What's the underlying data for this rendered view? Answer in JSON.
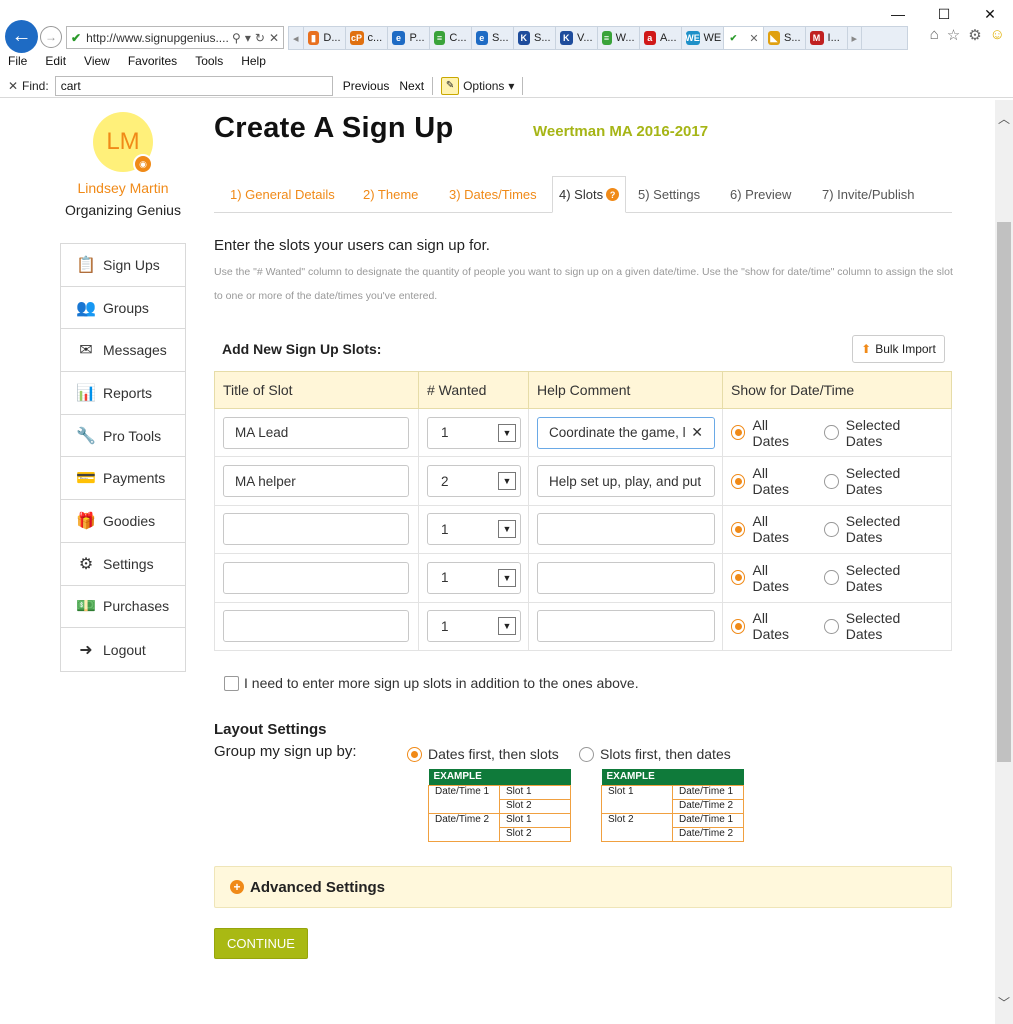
{
  "browser": {
    "address": "http://www.signupgenius....",
    "tabs": [
      {
        "label": "D...",
        "color": "#e8701f",
        "glyph": "▮"
      },
      {
        "label": "c...",
        "color": "#e07010",
        "glyph": "cP"
      },
      {
        "label": "P...",
        "color": "#1e6bc4",
        "glyph": "e"
      },
      {
        "label": "C...",
        "color": "#3aa33a",
        "glyph": "≡"
      },
      {
        "label": "S...",
        "color": "#1e6bc4",
        "glyph": "e"
      },
      {
        "label": "S...",
        "color": "#1e4c9c",
        "glyph": "K"
      },
      {
        "label": "V...",
        "color": "#1e4c9c",
        "glyph": "K"
      },
      {
        "label": "W...",
        "color": "#3aa33a",
        "glyph": "≡"
      },
      {
        "label": "A...",
        "color": "#d01818",
        "glyph": "a"
      },
      {
        "label": "WE",
        "color": "#1e90c8",
        "glyph": "WE"
      },
      {
        "label": "",
        "color": "#ffffff",
        "glyph": "✔"
      },
      {
        "label": "S...",
        "color": "#e0a010",
        "glyph": "◣"
      },
      {
        "label": "I...",
        "color": "#c02020",
        "glyph": "M"
      }
    ],
    "menu": [
      "File",
      "Edit",
      "View",
      "Favorites",
      "Tools",
      "Help"
    ],
    "find_label": "Find:",
    "find_value": "cart",
    "previous": "Previous",
    "next": "Next",
    "options": "Options"
  },
  "user": {
    "initials": "LM",
    "name": "Lindsey Martin",
    "role": "Organizing Genius"
  },
  "nav": [
    {
      "label": "Sign Ups",
      "icon": "clipboard-icon",
      "glyph": "📋"
    },
    {
      "label": "Groups",
      "icon": "people-icon",
      "glyph": "👥"
    },
    {
      "label": "Messages",
      "icon": "envelope-icon",
      "glyph": "✉"
    },
    {
      "label": "Reports",
      "icon": "bar-chart-icon",
      "glyph": "📊"
    },
    {
      "label": "Pro Tools",
      "icon": "wrench-icon",
      "glyph": "🔧"
    },
    {
      "label": "Payments",
      "icon": "credit-card-icon",
      "glyph": "💳"
    },
    {
      "label": "Goodies",
      "icon": "gift-icon",
      "glyph": "🎁"
    },
    {
      "label": "Settings",
      "icon": "gear-icon",
      "glyph": "⚙"
    },
    {
      "label": "Purchases",
      "icon": "money-icon",
      "glyph": "💵"
    },
    {
      "label": "Logout",
      "icon": "logout-icon",
      "glyph": "➜"
    }
  ],
  "page": {
    "title": "Create A Sign Up",
    "subtitle": "Weertman MA 2016-2017",
    "tabs": [
      "1) General Details",
      "2) Theme",
      "3) Dates/Times",
      "4) Slots",
      "5) Settings",
      "6) Preview",
      "7) Invite/Publish"
    ],
    "intro": "Enter the slots your users can sign up for.",
    "intro_help": "Use the \"# Wanted\" column to designate the quantity of people you want to sign up on a given date/time. Use the \"show for date/time\" column to assign the slot to one or more of the date/times you've entered.",
    "add_new_label": "Add New Sign Up Slots:",
    "bulk_import": "Bulk Import"
  },
  "table": {
    "headers": [
      "Title of Slot",
      "# Wanted",
      "Help Comment",
      "Show for Date/Time"
    ],
    "radio_all": "All Dates",
    "radio_selected": "Selected Dates",
    "rows": [
      {
        "title": "MA Lead",
        "wanted": "1",
        "comment": "Coordinate the game, l"
      },
      {
        "title": "MA helper",
        "wanted": "2",
        "comment": "Help set up, play, and put"
      },
      {
        "title": "",
        "wanted": "1",
        "comment": ""
      },
      {
        "title": "",
        "wanted": "1",
        "comment": ""
      },
      {
        "title": "",
        "wanted": "1",
        "comment": ""
      }
    ]
  },
  "more_slots_label": "I need to enter more sign up slots in addition to the ones above.",
  "layout": {
    "title": "Layout Settings",
    "group_by": "Group my sign up by:",
    "opt1": "Dates first, then slots",
    "opt2": "Slots first, then dates",
    "example_header": "EXAMPLE",
    "ex1": [
      [
        "Date/Time 1",
        "Slot 1"
      ],
      [
        "",
        "Slot 2"
      ],
      [
        "Date/Time 2",
        "Slot 1"
      ],
      [
        "",
        "Slot 2"
      ]
    ],
    "ex2": [
      [
        "Slot 1",
        "Date/Time 1"
      ],
      [
        "",
        "Date/Time 2"
      ],
      [
        "Slot 2",
        "Date/Time 1"
      ],
      [
        "",
        "Date/Time 2"
      ]
    ]
  },
  "advanced": "Advanced Settings",
  "continue": "CONTINUE"
}
